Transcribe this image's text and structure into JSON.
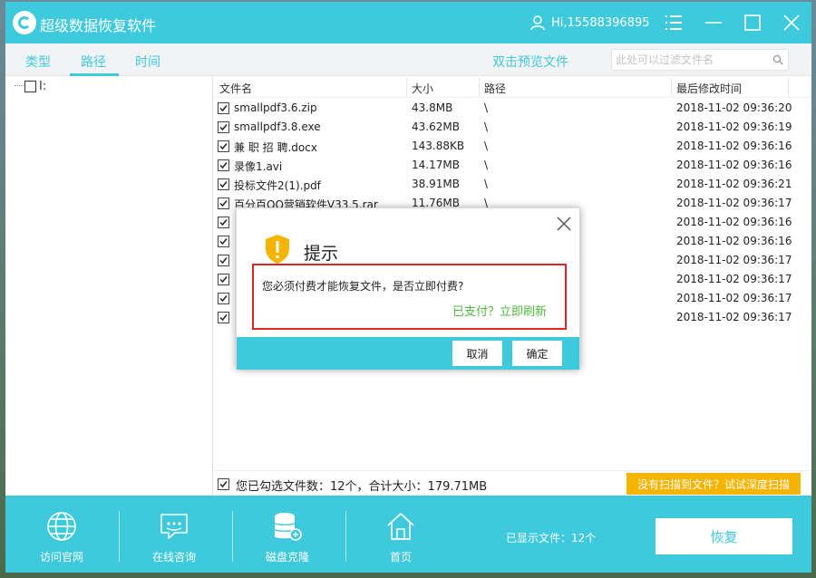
{
  "window": {
    "title": "超级数据恢复软件",
    "user": "Hi,15588396895"
  },
  "tabs": {
    "type": "类型",
    "path": "路径",
    "time": "时间",
    "preview": "双击预览文件",
    "filter_placeholder": "此处可以过滤文件名"
  },
  "tree": {
    "root_label": "I:"
  },
  "table": {
    "headers": {
      "name": "文件名",
      "size": "大小",
      "path": "路径",
      "modified": "最后修改时间"
    },
    "rows": [
      {
        "name": "smallpdf3.6.zip",
        "size": "43.8MB",
        "path": "\\",
        "modified": "2018-11-02 09:36:20"
      },
      {
        "name": "smallpdf3.8.exe",
        "size": "43.62MB",
        "path": "\\",
        "modified": "2018-11-02 09:36:19"
      },
      {
        "name": "兼 职 招 聘.docx",
        "size": "143.88KB",
        "path": "\\",
        "modified": "2018-11-02 09:36:16"
      },
      {
        "name": "录像1.avi",
        "size": "14.17MB",
        "path": "\\",
        "modified": "2018-11-02 09:36:16"
      },
      {
        "name": "投标文件2(1).pdf",
        "size": "38.91MB",
        "path": "\\",
        "modified": "2018-11-02 09:36:21"
      },
      {
        "name": "百分百QQ营销软件V33.5.rar",
        "size": "11.76MB",
        "path": "\\",
        "modified": "2018-11-02 09:36:17"
      },
      {
        "name": "",
        "size": "",
        "path": "",
        "modified": "2018-11-02 09:36:16"
      },
      {
        "name": "",
        "size": "",
        "path": "",
        "modified": "2018-11-02 09:36:16"
      },
      {
        "name": "",
        "size": "",
        "path": "",
        "modified": "2018-11-02 09:36:17"
      },
      {
        "name": "",
        "size": "",
        "path": "",
        "modified": "2018-11-02 09:36:17"
      },
      {
        "name": "",
        "size": "",
        "path": "",
        "modified": "2018-11-02 09:36:17"
      },
      {
        "name": "",
        "size": "",
        "path": "",
        "modified": "2018-11-02 09:36:17"
      }
    ]
  },
  "summary": {
    "text": "您已勾选文件数：12个，合计大小：179.71MB",
    "deep_scan": "没有扫描到文件？试试深度扫描"
  },
  "bottom": {
    "nav": [
      {
        "label": "访问官网",
        "icon": "globe-icon"
      },
      {
        "label": "在线咨询",
        "icon": "chat-icon"
      },
      {
        "label": "磁盘克隆",
        "icon": "disk-clone-icon"
      },
      {
        "label": "首页",
        "icon": "home-icon"
      }
    ],
    "shown_count": "已显示文件：12个",
    "recover": "恢复"
  },
  "modal": {
    "title": "提示",
    "message": "您必须付费才能恢复文件，是否立即付费?",
    "paid_link": "已支付？立即刷新",
    "cancel": "取消",
    "ok": "确定"
  },
  "colors": {
    "accent": "#3ec9dd",
    "warning": "#f5b400",
    "highlight_border": "#e02424",
    "link_green": "#4fba3e"
  }
}
